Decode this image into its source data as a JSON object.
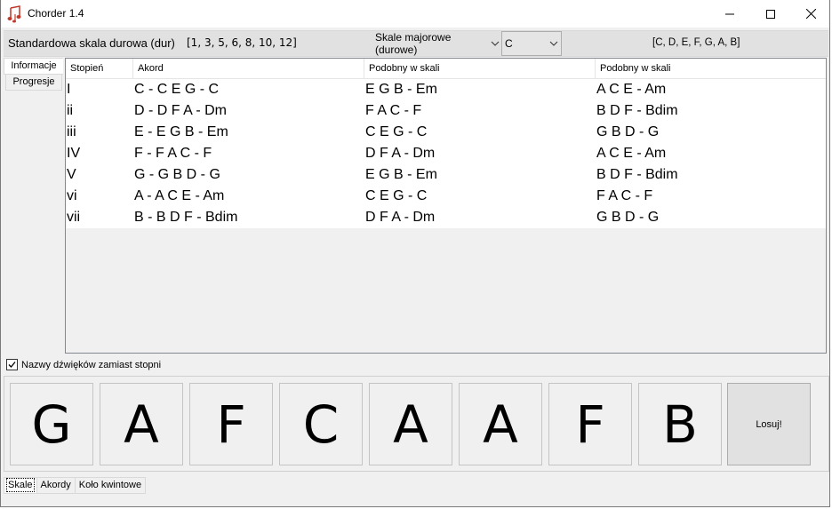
{
  "window": {
    "title": "Chorder 1.4"
  },
  "topbar": {
    "scale_name": "Standardowa skala durowa (dur)",
    "intervals": "[1, 3, 5, 6, 8, 10, 12]",
    "scale_type": "Skale majorowe (durowe)",
    "key": "C",
    "scale_notes": "[C, D, E, F, G, A, B]"
  },
  "side_tabs": [
    "Informacje",
    "Progresje"
  ],
  "table": {
    "columns": [
      "Stopień",
      "Akord",
      "Podobny w skali",
      "Podobny w skali"
    ],
    "rows": [
      [
        "I",
        "C - C E G - C",
        "E G B - Em",
        "A C E - Am"
      ],
      [
        "ii",
        "D - D F A - Dm",
        "F A C - F",
        "B D F - Bdim"
      ],
      [
        "iii",
        "E - E G B - Em",
        "C E G - C",
        "G B D - G"
      ],
      [
        "IV",
        "F - F A C - F",
        "D F A - Dm",
        "A C E - Am"
      ],
      [
        "V",
        "G - G B D - G",
        "E G B - Em",
        "B D F - Bdim"
      ],
      [
        "vi",
        "A - A C E - Am",
        "C E G - C",
        "F A C - F"
      ],
      [
        "vii",
        "B - B D F - Bdim",
        "D F A - Dm",
        "G B D - G"
      ]
    ]
  },
  "options": {
    "note_names_label": "Nazwy dźwięków zamiast stopni",
    "note_names_checked": true
  },
  "note_boxes": [
    "G",
    "A",
    "F",
    "C",
    "A",
    "A",
    "F",
    "B"
  ],
  "random_button": "Losuj!",
  "bottom_tabs": [
    "Skale",
    "Akordy",
    "Koło kwintowe"
  ],
  "active_bottom_tab": "Skale"
}
